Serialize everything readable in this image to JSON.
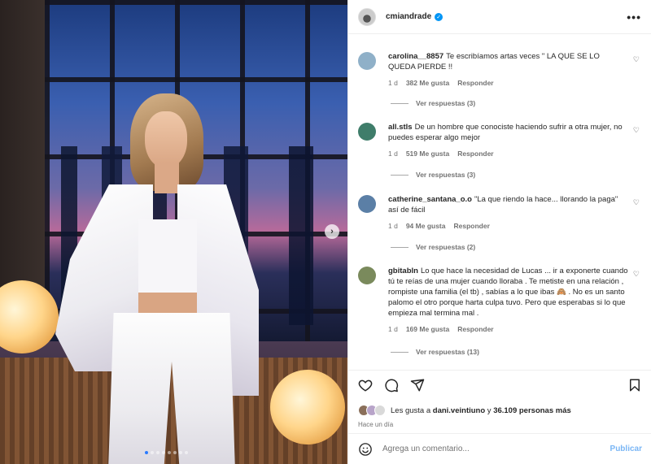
{
  "post": {
    "username": "cmiandrade",
    "verified": true,
    "more_label": "•••"
  },
  "comments": [
    {
      "user": "carolina__8857",
      "text": "Te escribíamos artas veces \" LA QUE SE LO QUEDA PIERDE !!",
      "time": "1 d",
      "likes": "382 Me gusta",
      "reply_label": "Responder",
      "view_replies": "Ver respuestas (3)",
      "avatar_color": "#8fb0c8"
    },
    {
      "user": "all.stls",
      "text": "De un hombre que conociste haciendo sufrir a otra mujer, no puedes esperar algo mejor",
      "time": "1 d",
      "likes": "519 Me gusta",
      "reply_label": "Responder",
      "view_replies": "Ver respuestas (3)",
      "avatar_color": "#3f7d6a"
    },
    {
      "user": "catherine_santana_o.o",
      "text": "\"La que riendo la hace... llorando la paga\" así de fácil",
      "time": "1 d",
      "likes": "94 Me gusta",
      "reply_label": "Responder",
      "view_replies": "Ver respuestas (2)",
      "avatar_color": "#5b7fa6"
    },
    {
      "user": "gbitabln",
      "text": "Lo que hace la necesidad de Lucas ... ir a exponerte cuando tú te reías de una mujer cuando lloraba . Te metiste en una relación , rompiste una familia (el tb) , sabías a lo que ibas 🙈 . No es un santo palomo el otro porque harta culpa tuvo. Pero que esperabas si lo que empieza mal termina mal .",
      "time": "1 d",
      "likes": "169 Me gusta",
      "reply_label": "Responder",
      "view_replies": "Ver respuestas (13)",
      "avatar_color": "#7a8a5c"
    }
  ],
  "likes_line": {
    "prefix": "Les gusta a",
    "user": "dani.veintiuno",
    "connector": "y",
    "others": "36.109 personas más"
  },
  "posted_ago": "Hace un día",
  "comment_box": {
    "placeholder": "Agrega un comentario...",
    "publish_label": "Publicar"
  },
  "icons": {
    "like": "heart-icon",
    "comment": "comment-icon",
    "share": "send-icon",
    "save": "bookmark-icon",
    "emoji": "emoji-icon",
    "next": "chevron-right-icon"
  },
  "carousel": {
    "total": 8,
    "current": 1
  }
}
